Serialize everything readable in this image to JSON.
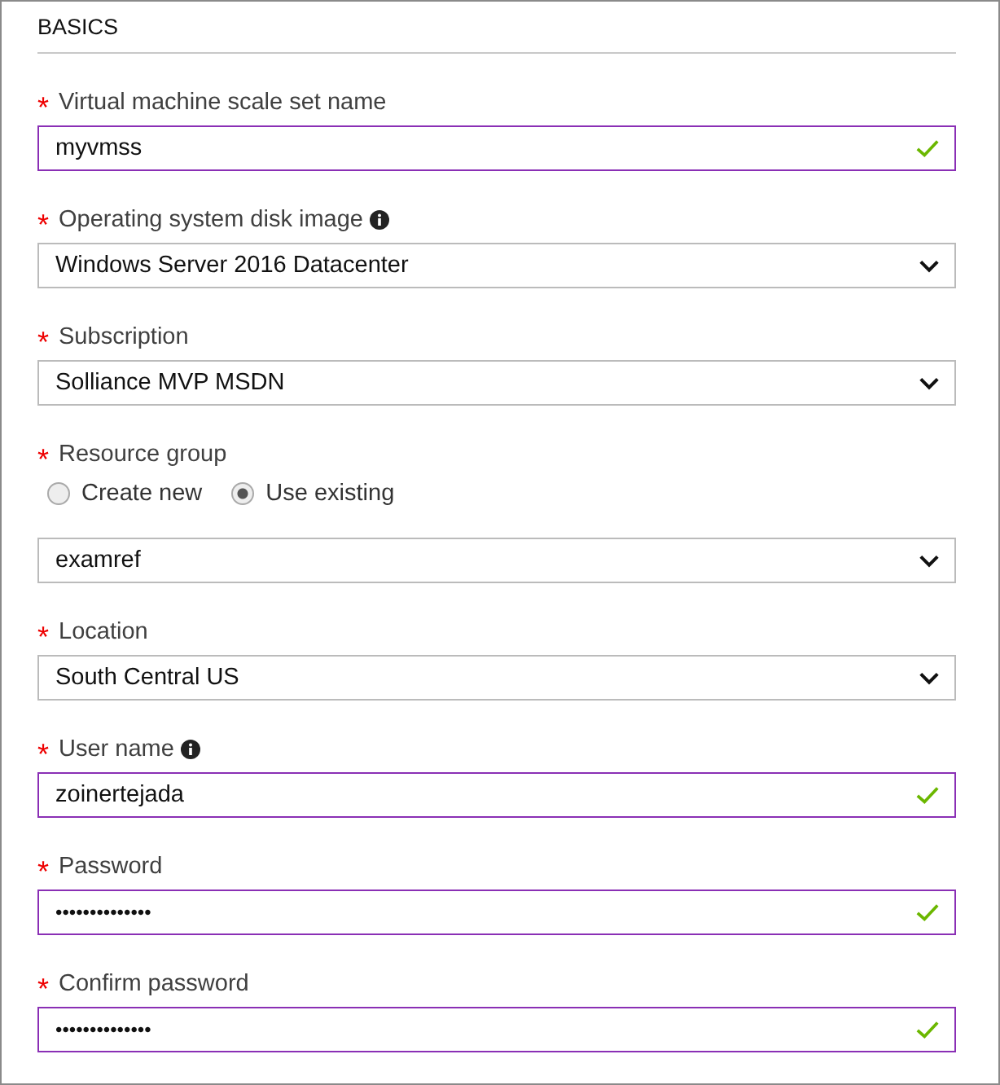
{
  "section": {
    "title": "BASICS"
  },
  "fields": [
    {
      "kind": "text",
      "label": "Virtual machine scale set name",
      "marker": "*",
      "info": false,
      "value": "myvmss",
      "valid": true
    },
    {
      "kind": "select",
      "label": "Operating system disk image",
      "marker": "*",
      "info": true,
      "value": "Windows Server 2016 Datacenter"
    },
    {
      "kind": "select",
      "label": "Subscription",
      "marker": "*",
      "info": false,
      "value": "Solliance MVP MSDN"
    },
    {
      "kind": "radio-select",
      "label": "Resource group",
      "marker": "*",
      "info": false,
      "options": [
        {
          "label": "Create new",
          "selected": false
        },
        {
          "label": "Use existing",
          "selected": true
        }
      ],
      "value": "examref"
    },
    {
      "kind": "select",
      "label": "Location",
      "marker": "*",
      "info": false,
      "value": "South Central US"
    },
    {
      "kind": "text",
      "label": "User name",
      "marker": "*",
      "info": true,
      "value": "zoinertejada",
      "valid": true
    },
    {
      "kind": "password",
      "label": "Password",
      "marker": "*",
      "info": false,
      "value": "••••••••••••••",
      "valid": true
    },
    {
      "kind": "password",
      "label": "Confirm password",
      "marker": "*",
      "info": false,
      "value": "••••••••••••••",
      "valid": true
    }
  ]
}
